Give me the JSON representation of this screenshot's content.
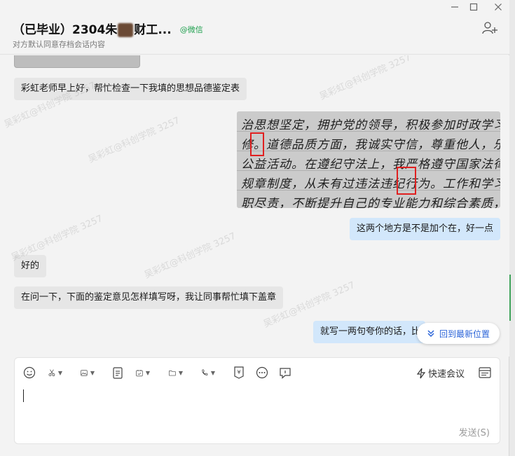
{
  "header": {
    "title_prefix": "（已毕业）2304朱",
    "title_suffix": "财工...",
    "wechat_tag": "@微信",
    "subtitle": "对方默认同意存档会话内容"
  },
  "window_controls": [
    "minimize-icon",
    "maximize-icon",
    "close-icon"
  ],
  "messages": [
    {
      "side": "in",
      "text": "彩虹老师早上好，帮忙检查一下我填的思想品德鉴定表"
    },
    {
      "side": "out",
      "type": "image"
    },
    {
      "side": "out",
      "text": "这两个地方是不是加个在，好一点"
    },
    {
      "side": "in",
      "text": "好的"
    },
    {
      "side": "in",
      "text": "在问一下，下面的鉴定意见怎样填写呀，我让同事帮忙填下盖章"
    },
    {
      "side": "out",
      "text": "就写一两句夸你的话，比"
    }
  ],
  "handwriting": [
    "治思想坚定，拥护党的领导，积极参加时政学习，不断提升",
    "修。道德品质方面，我诚实守信，尊重他人，乐于助人，",
    "公益活动。在遵纪守法上，我严格遵守国家法律法",
    "规章制度，从未有过违法违纪行为。工作和学习中，我勤",
    "职尽责，不断提升自己的专业能力和综合素质，取得"
  ],
  "watermark_text": "吴彩虹@科创学院 3257",
  "jump_button": {
    "label": "回到最新位置",
    "icon": "double-chevron-down-icon"
  },
  "composer": {
    "toolbar": [
      {
        "name": "emoji-icon"
      },
      {
        "name": "scissors-icon",
        "dropdown": true
      },
      {
        "name": "image-icon",
        "dropdown": true
      },
      {
        "name": "document-icon"
      },
      {
        "name": "calendar-check-icon",
        "dropdown": true
      },
      {
        "name": "folder-icon",
        "dropdown": true
      },
      {
        "name": "phone-icon",
        "dropdown": true
      },
      {
        "name": "red-packet-icon"
      },
      {
        "name": "more-icon"
      },
      {
        "name": "chat-bubble-icon"
      }
    ],
    "quick_meeting_label": "快速会议",
    "send_label": "发送(S)"
  }
}
